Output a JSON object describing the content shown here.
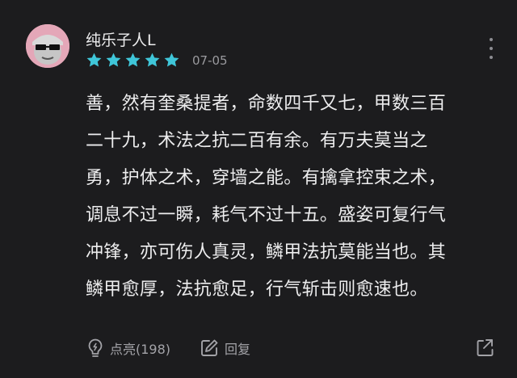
{
  "comment": {
    "username": "纯乐子人L",
    "rating": 5,
    "date": "07-05",
    "lines": [
      "善，然有奎桑提者，命数四千又七，甲数三百",
      "二十九，术法之抗二百有余。有万夫莫当之",
      "勇，护体之术，穿墙之能。有擒拿控束之术，",
      "调息不过一瞬，耗气不过十五。盛姿可复行气",
      "冲锋，亦可伤人真灵，鳞甲法抗莫能当也。其",
      "鳞甲愈厚，法抗愈足，行气斩击则愈速也。"
    ]
  },
  "actions": {
    "like_label": "点亮(198)",
    "reply_label": "回复"
  },
  "colors": {
    "background": "#1c1c1e",
    "star": "#3fc6d9",
    "text": "#ededee",
    "muted": "#9a9a9e",
    "avatar_bg": "#e4a7b8"
  },
  "icons": {
    "more": "more-vertical-icon",
    "like": "lightbulb-icon",
    "reply": "edit-pen-icon",
    "share": "share-icon"
  }
}
